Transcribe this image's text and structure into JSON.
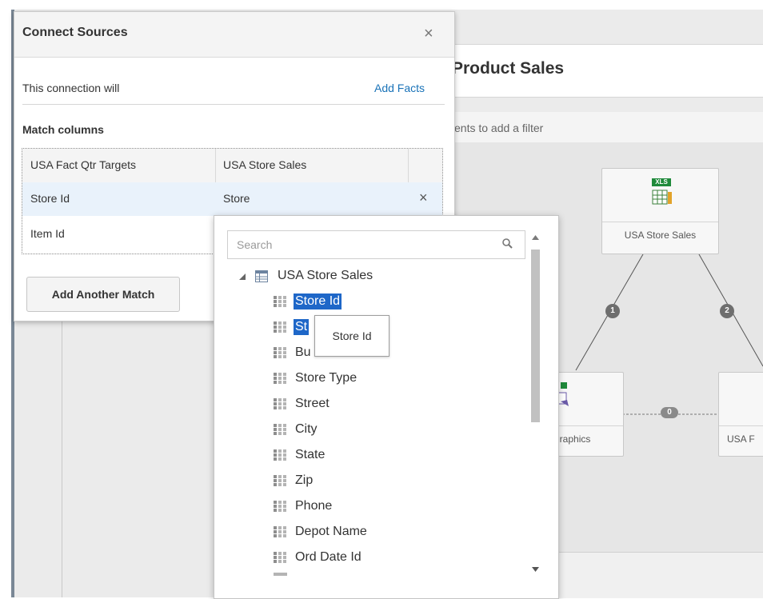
{
  "background": {
    "page_title": "Product Sales",
    "filter_hint": "ents to add a filter",
    "nodes": {
      "top": {
        "label": "USA Store Sales",
        "file_badge": "XLS"
      },
      "bottom_left": {
        "label": "graphics"
      },
      "bottom_right": {
        "label": "USA F"
      }
    },
    "badges": {
      "one": "1",
      "two": "2",
      "zero": "0"
    }
  },
  "dialog": {
    "title": "Connect Sources",
    "close_symbol": "×",
    "connection_text": "This connection will",
    "connection_action": "Add Facts",
    "match_label": "Match columns",
    "table": {
      "headers": [
        "USA Fact Qtr Targets",
        "USA Store Sales"
      ],
      "rows": [
        {
          "left": "Store Id",
          "right": "Store",
          "remove": "×"
        },
        {
          "left": "Item Id",
          "right": "",
          "remove": ""
        }
      ]
    },
    "add_match_button": "Add Another Match"
  },
  "dropdown": {
    "search_placeholder": "Search",
    "root_label": "USA Store Sales",
    "items": [
      "Store Id",
      "St",
      "Bu",
      "Store Type",
      "Street",
      "City",
      "State",
      "Zip",
      "Phone",
      "Depot Name",
      "Ord Date Id"
    ],
    "tooltip": "Store Id"
  },
  "colors": {
    "selection": "#1e67c8",
    "link": "#1a73b8",
    "xls_green": "#1f8a3b"
  }
}
